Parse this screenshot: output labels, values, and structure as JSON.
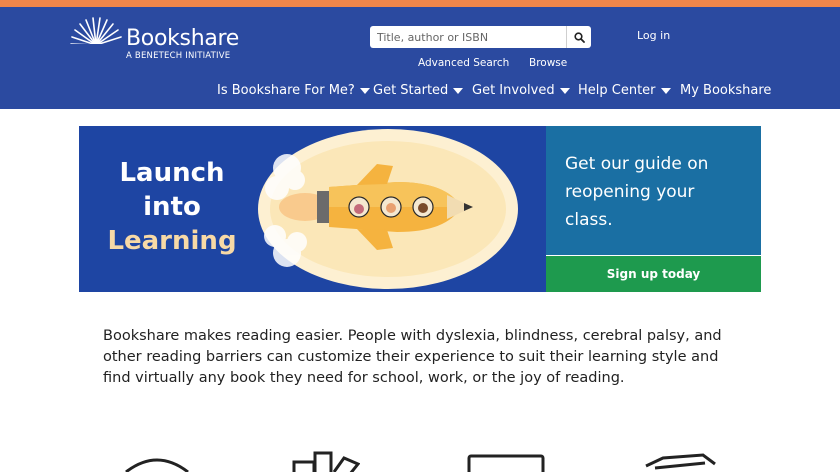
{
  "brand": {
    "name": "Bookshare",
    "tagline": "A BENETECH INITIATIVE"
  },
  "search": {
    "placeholder": "Title, author or ISBN"
  },
  "header_links": {
    "login": "Log in",
    "advanced_search": "Advanced Search",
    "browse": "Browse"
  },
  "nav": [
    {
      "label": "Is Bookshare For Me?",
      "dropdown": true
    },
    {
      "label": "Get Started",
      "dropdown": true
    },
    {
      "label": "Get Involved",
      "dropdown": true
    },
    {
      "label": "Help Center",
      "dropdown": true
    },
    {
      "label": "My Bookshare",
      "dropdown": false
    }
  ],
  "banner": {
    "line1": "Launch",
    "line2": "into",
    "line3": "Learning"
  },
  "promo": {
    "text": "Get our guide on reopening your class.",
    "button": "Sign up today"
  },
  "intro": "Bookshare makes reading easier. People with dyslexia, blindness, cerebral palsy, and other reading barriers can customize their experience to suit their learning style and find virtually any book they need for school, work, or the joy of reading.",
  "colors": {
    "header": "#2b4aa0",
    "top_stripe": "#f0864a",
    "banner_bg": "#1e45a3",
    "promo_bg": "#1a6fa3",
    "signup_bg": "#1e9a4e"
  }
}
